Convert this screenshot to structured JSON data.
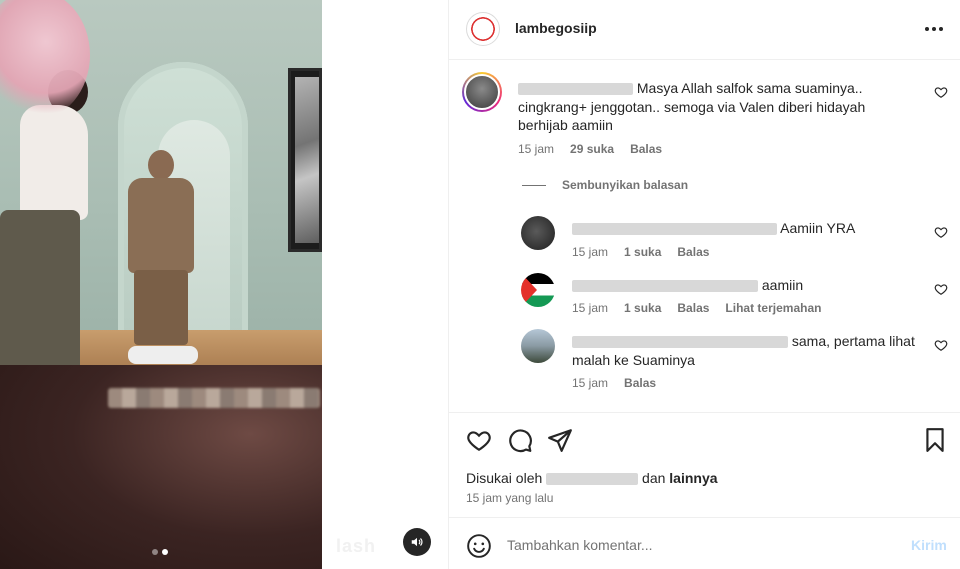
{
  "post": {
    "username": "lambegosiip",
    "more_icon": "more-horizontal-icon",
    "watermark": "lash",
    "carousel": {
      "count": 2,
      "active": 2
    }
  },
  "main_comment": {
    "text": "Masya Allah salfok sama suaminya.. cingkrang+ jenggotan.. semoga via Valen diberi hidayah berhijab aamiin",
    "time": "15 jam",
    "likes": "29 suka",
    "reply": "Balas"
  },
  "hide_replies": "Sembunyikan balasan",
  "replies": [
    {
      "text": "Aamiin YRA",
      "time": "15 jam",
      "likes": "1 suka",
      "reply": "Balas",
      "translate": ""
    },
    {
      "text": "aamiin",
      "time": "15 jam",
      "likes": "1 suka",
      "reply": "Balas",
      "translate": "Lihat terjemahan"
    },
    {
      "text": "sama, pertama lihat malah ke Suaminya",
      "time": "15 jam",
      "likes": "",
      "reply": "Balas",
      "translate": ""
    }
  ],
  "actions": {
    "liked_prefix": "Disukai oleh",
    "liked_mid": "dan",
    "liked_others": "lainnya",
    "time_ago": "15 jam yang lalu"
  },
  "composer": {
    "placeholder": "Tambahkan komentar...",
    "post_label": "Kirim"
  },
  "colors": {
    "accent_disabled": "#c0dffd",
    "secondary_text": "#737373",
    "primary_text": "#262626"
  }
}
